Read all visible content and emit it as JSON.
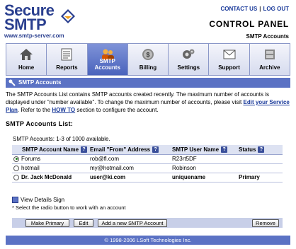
{
  "header": {
    "logo_line1": "Secure",
    "logo_line2": "SMTP",
    "logo_url": "www.smtp-server.com",
    "contact_label": "CONTACT US",
    "logout_label": "LOG OUT",
    "separator": "|",
    "title": "CONTROL PANEL",
    "subtitle": "SMTP Accounts"
  },
  "nav": {
    "tabs": [
      {
        "label": "Home",
        "icon": "home-icon"
      },
      {
        "label": "Reports",
        "icon": "reports-icon"
      },
      {
        "label": "SMTP Accounts",
        "icon": "users-icon"
      },
      {
        "label": "Billing",
        "icon": "billing-icon"
      },
      {
        "label": "Settings",
        "icon": "gear-icon"
      },
      {
        "label": "Support",
        "icon": "support-icon"
      },
      {
        "label": "Archive",
        "icon": "archive-icon"
      }
    ],
    "active_tab": "SMTP Accounts"
  },
  "section": {
    "title": "SMTP Accounts",
    "desc_1": "The SMTP Accounts List contains SMTP accounts created recently. The maximum number of accounts is displayed under \"number available\". To change the maximum number of accounts, please visit ",
    "desc_link1": "Edit your Service Plan",
    "desc_2": ". Refer to the ",
    "desc_link2": "HOW TO",
    "desc_3": " section to configure the account."
  },
  "list": {
    "title": "SMTP Accounts List:",
    "count": "SMTP Accounts: 1-3 of 1000 available.",
    "columns": [
      "SMTP Account Name",
      "Email \"From\" Address",
      "SMTP User Name",
      "Status"
    ],
    "help_glyph": "?",
    "rows": [
      {
        "name": "Forums",
        "email": "rob@fl.com",
        "user": "R23rt5DF",
        "status": "",
        "selected": true,
        "bold": false
      },
      {
        "name": "hotmail",
        "email": "my@hotmail.com",
        "user": "Robinson",
        "status": "",
        "selected": false,
        "bold": false
      },
      {
        "name": "Dr. Jack McDonald",
        "email": "user@ki.com",
        "user": "uniquename",
        "status": "Primary",
        "selected": false,
        "bold": true
      }
    ],
    "details_label": "View Details Sign",
    "hint": "* Select the radio button to work with an account"
  },
  "buttons": {
    "make_primary": "Make Primary",
    "edit": "Edit",
    "add": "Add a new SMTP Account",
    "remove": "Remove"
  },
  "footer": {
    "copyright": "© 1998-2006 LSoft Technologies Inc."
  },
  "colors": {
    "brand": "#2a3f8f",
    "bar": "#5b72c4",
    "active_tab": "#4a63bc"
  }
}
